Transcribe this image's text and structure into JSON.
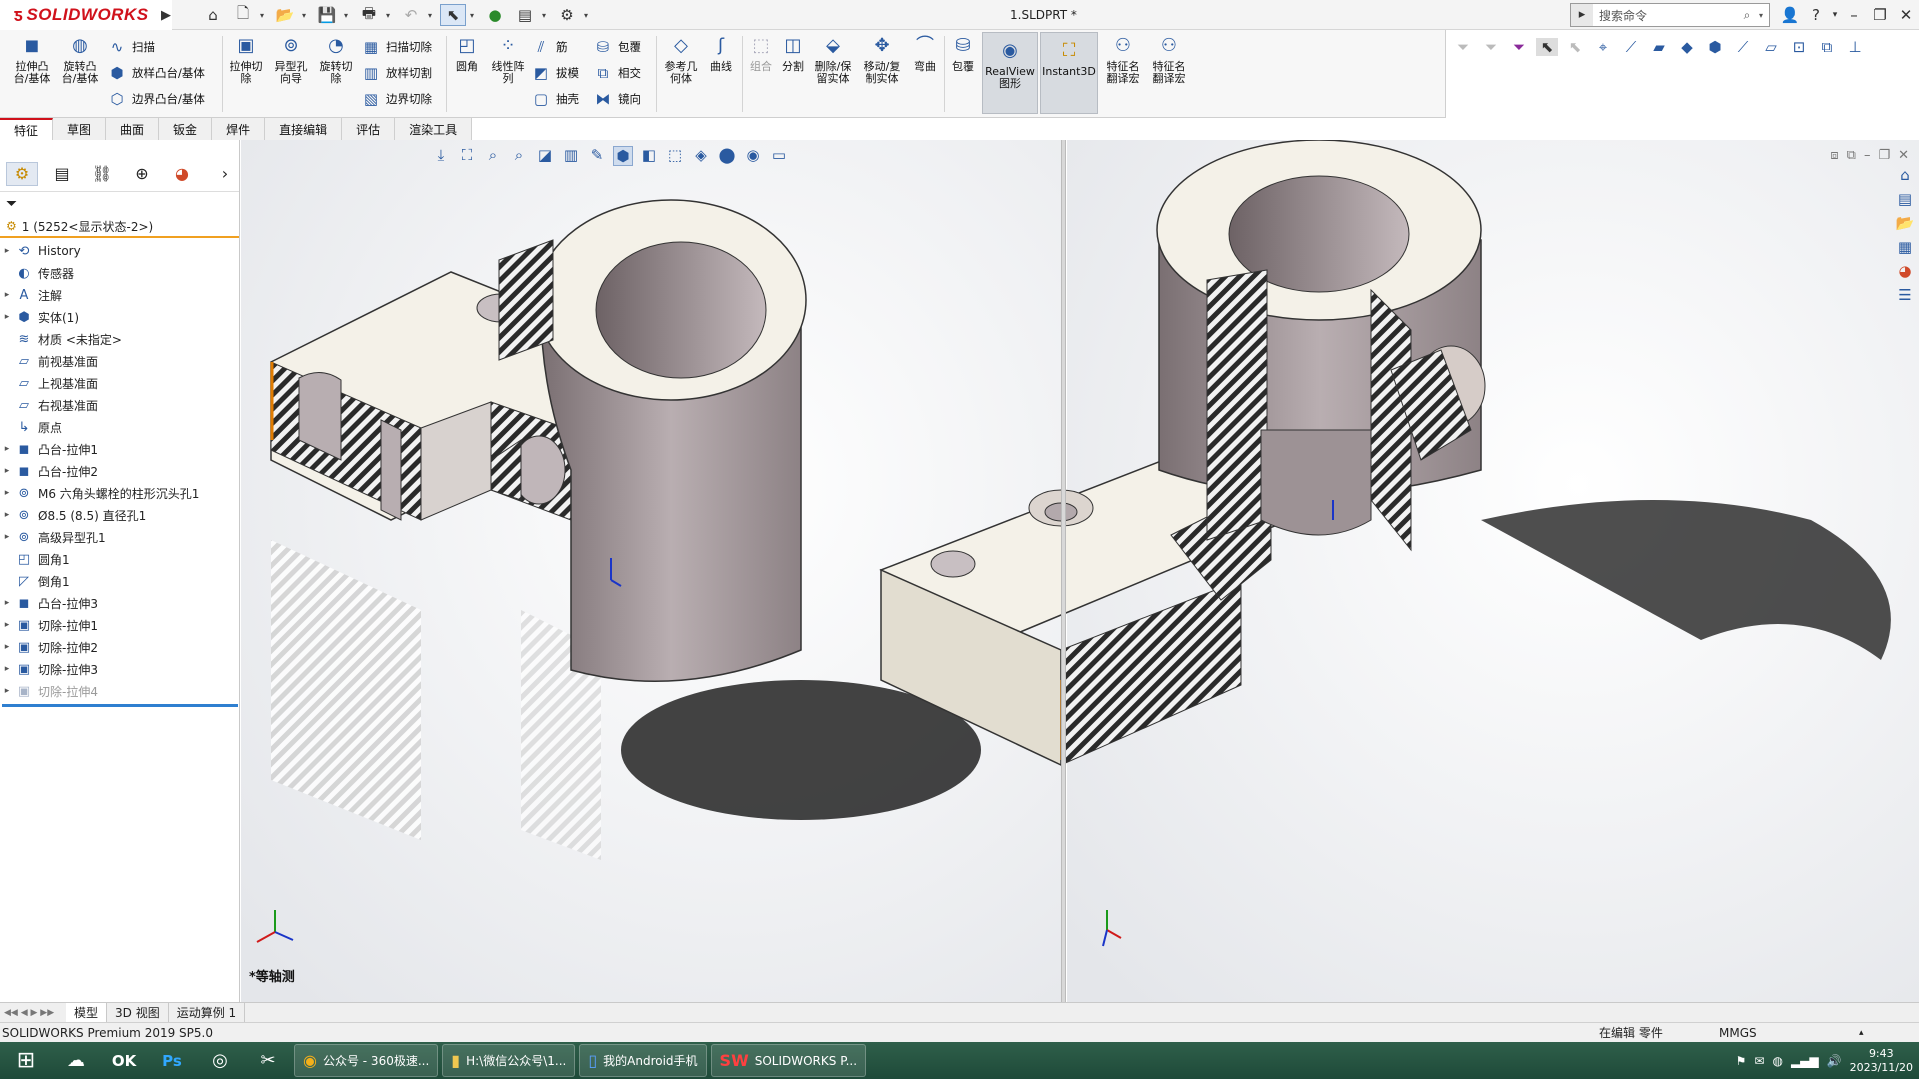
{
  "app": {
    "brand": "SOLIDWORKS",
    "doc_title": "1.SLDPRT *",
    "search_placeholder": "搜索命令"
  },
  "quick_access": [
    "home-icon",
    "new-icon",
    "open-icon",
    "save-icon",
    "print-icon",
    "undo-icon",
    "select-icon",
    "traffic-light-icon",
    "rebuild-icon",
    "options-icon"
  ],
  "ribbon": {
    "extrude_boss": "拉伸凸\n台/基体",
    "revolve_boss": "旋转凸\n台/基体",
    "sweep": "扫描",
    "loft_boss": "放样凸台/基体",
    "boundary_boss": "边界凸台/基体",
    "extrude_cut": "拉伸切\n除",
    "hole_wizard": "异型孔\n向导",
    "revolve_cut": "旋转切\n除",
    "swept_cut": "扫描切除",
    "lofted_cut": "放样切割",
    "boundary_cut": "边界切除",
    "fillet": "圆角",
    "linear_pattern": "线性阵\n列",
    "rib": "筋",
    "draft": "拔模",
    "shell": "抽壳",
    "wrap": "包覆",
    "intersect": "相交",
    "mirror": "镜向",
    "ref_geometry": "参考几\n何体",
    "curves": "曲线",
    "combine": "组合",
    "split": "分割",
    "delete_keep_body": "删除/保\n留实体",
    "move_copy_body": "移动/复\n制实体",
    "flex": "弯曲",
    "wrap2": "包覆",
    "realview": "RealView\n图形",
    "instant3d": "Instant3D",
    "feature_name_translate1": "特征名\n翻译宏",
    "feature_name_translate2": "特征名\n翻译宏"
  },
  "tabs": [
    "特征",
    "草图",
    "曲面",
    "钣金",
    "焊件",
    "直接编辑",
    "评估",
    "渲染工具"
  ],
  "feature_manager": {
    "root": "1  (5252<显示状态-2>)",
    "nodes": [
      {
        "label": "History",
        "icon": "history-icon",
        "expand": true
      },
      {
        "label": "传感器",
        "icon": "sensor-icon",
        "expand": false
      },
      {
        "label": "注解",
        "icon": "annotation-icon",
        "expand": true
      },
      {
        "label": "实体(1)",
        "icon": "solid-bodies-icon",
        "expand": true
      },
      {
        "label": "材质 <未指定>",
        "icon": "material-icon",
        "expand": false
      },
      {
        "label": "前视基准面",
        "icon": "plane-icon",
        "expand": false
      },
      {
        "label": "上视基准面",
        "icon": "plane-icon",
        "expand": false
      },
      {
        "label": "右视基准面",
        "icon": "plane-icon",
        "expand": false
      },
      {
        "label": "原点",
        "icon": "origin-icon",
        "expand": false
      },
      {
        "label": "凸台-拉伸1",
        "icon": "extrude-icon",
        "expand": true
      },
      {
        "label": "凸台-拉伸2",
        "icon": "extrude-icon",
        "expand": true
      },
      {
        "label": "M6 六角头螺栓的柱形沉头孔1",
        "icon": "hole-icon",
        "expand": true
      },
      {
        "label": "Ø8.5 (8.5) 直径孔1",
        "icon": "hole-icon",
        "expand": true
      },
      {
        "label": "高级异型孔1",
        "icon": "hole-icon",
        "expand": true
      },
      {
        "label": "圆角1",
        "icon": "fillet-icon",
        "expand": false
      },
      {
        "label": "倒角1",
        "icon": "chamfer-icon",
        "expand": false
      },
      {
        "label": "凸台-拉伸3",
        "icon": "extrude-icon",
        "expand": true
      },
      {
        "label": "切除-拉伸1",
        "icon": "cut-icon",
        "expand": true
      },
      {
        "label": "切除-拉伸2",
        "icon": "cut-icon",
        "expand": true
      },
      {
        "label": "切除-拉伸3",
        "icon": "cut-icon",
        "expand": true
      },
      {
        "label": "切除-拉伸4",
        "icon": "cut-icon",
        "expand": true,
        "suppressed": true
      }
    ]
  },
  "view": {
    "name": "*等轴测"
  },
  "bottom_tabs": [
    "模型",
    "3D 视图",
    "运动算例 1"
  ],
  "status": {
    "version": "SOLIDWORKS Premium 2019 SP5.0",
    "mode": "在编辑 零件",
    "units": "MMGS"
  },
  "taskbar": {
    "tasks": [
      "公众号 - 360极速...",
      "H:\\微信公众号\\1...",
      "我的Android手机",
      "SOLIDWORKS P..."
    ],
    "time": "9:43",
    "date": "2023/11/20"
  },
  "colors": {
    "brand_red": "#d0111b",
    "accent_blue": "#2a5aa0",
    "rollback_bar": "#2f7fd0",
    "root_underline": "#f0a020"
  }
}
